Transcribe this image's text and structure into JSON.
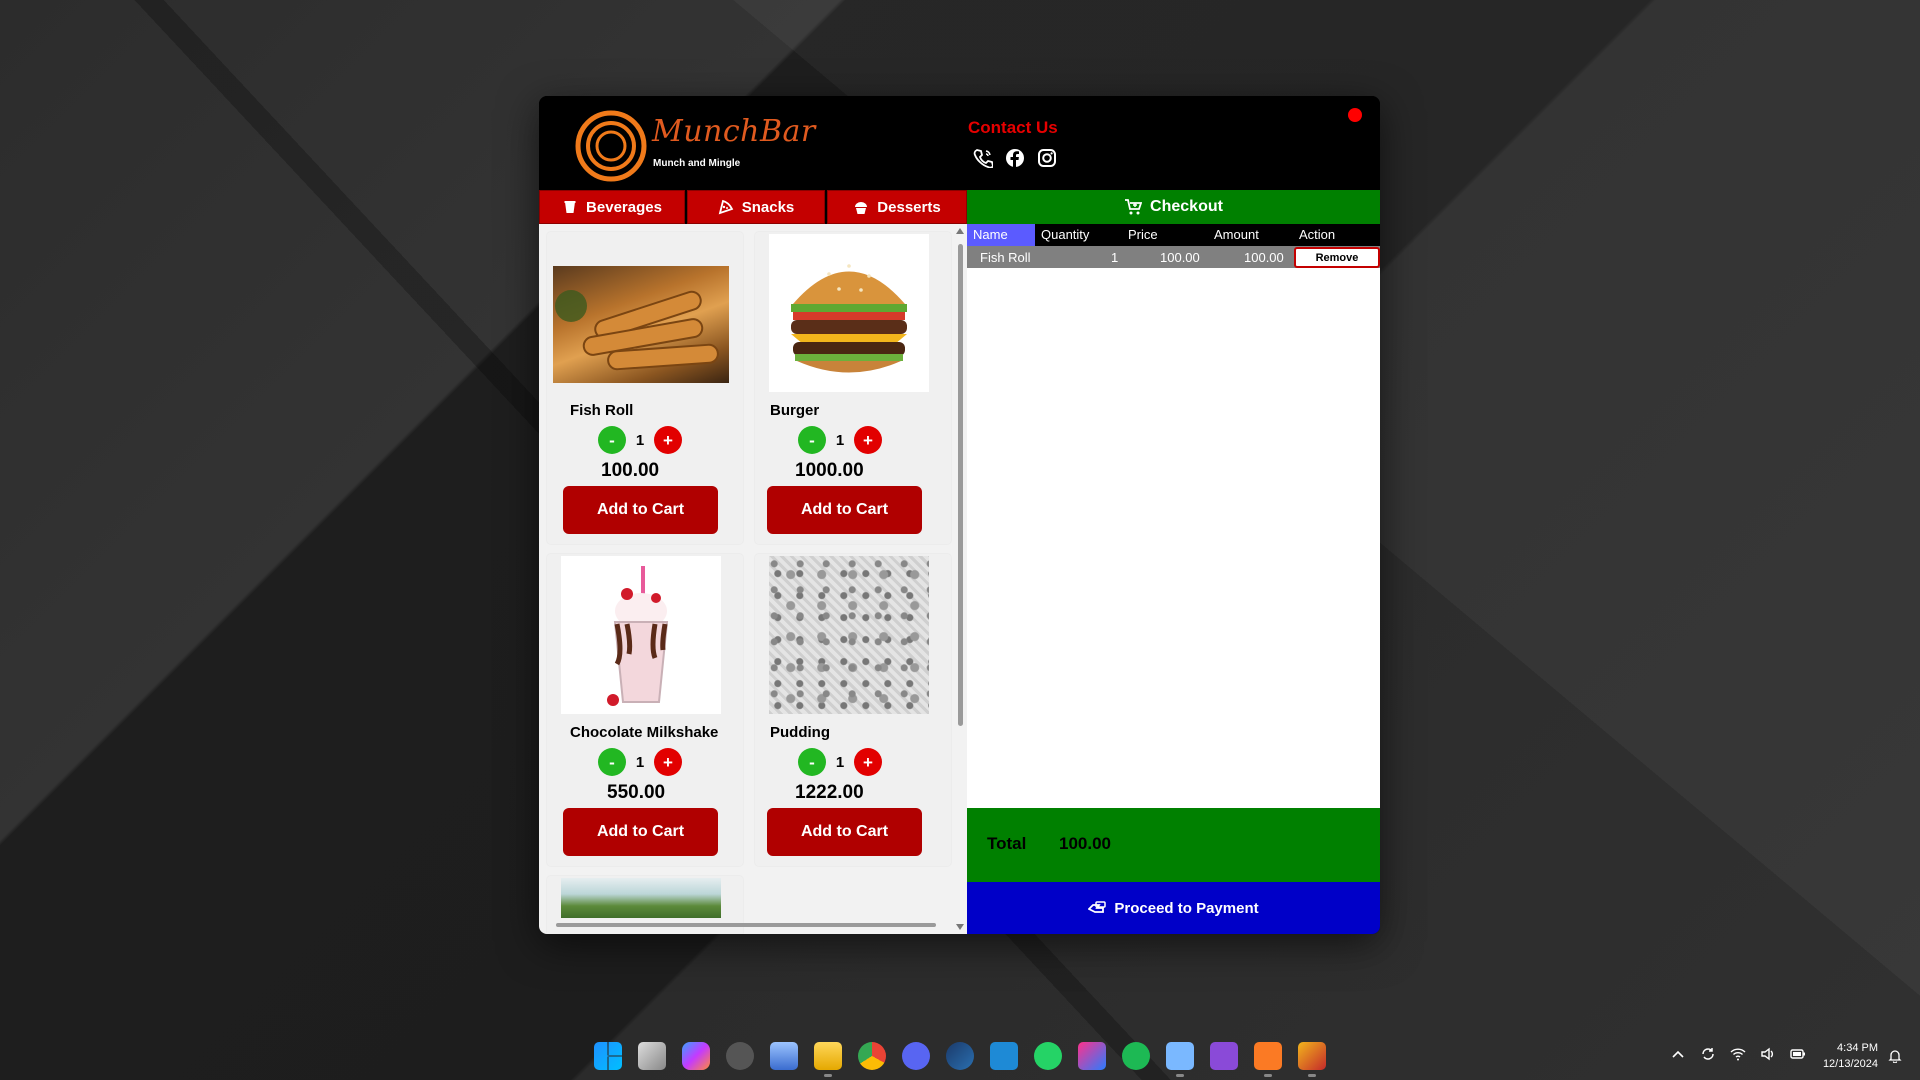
{
  "header": {
    "brand_name": "MunchBar",
    "brand_tagline": "Munch and Mingle",
    "contact_title": "Contact Us",
    "contact_icons": [
      "phone-icon",
      "facebook-icon",
      "instagram-icon"
    ],
    "close_color": "#ff0000"
  },
  "tabs": [
    {
      "label": "Beverages",
      "icon": "cup-icon"
    },
    {
      "label": "Snacks",
      "icon": "pizza-slice-icon"
    },
    {
      "label": "Desserts",
      "icon": "cupcake-icon"
    }
  ],
  "products": [
    {
      "name": "Fish Roll",
      "qty": "1",
      "price": "100.00",
      "button": "Add to Cart",
      "image": "fish-roll-image"
    },
    {
      "name": "Burger",
      "qty": "1",
      "price": "1000.00",
      "button": "Add to Cart",
      "image": "burger-image"
    },
    {
      "name": "Chocolate Milkshake",
      "qty": "1",
      "price": "550.00",
      "button": "Add to Cart",
      "image": "milkshake-image"
    },
    {
      "name": "Pudding",
      "qty": "1",
      "price": "1222.00",
      "button": "Add to Cart",
      "image": "pattern-placeholder-image"
    }
  ],
  "stepper": {
    "minus": "-",
    "plus": "+"
  },
  "checkout": {
    "title": "Checkout",
    "columns": [
      "Name",
      "Quantity",
      "Price",
      "Amount",
      "Action"
    ],
    "rows": [
      {
        "name": "Fish Roll",
        "quantity": "1",
        "price": "100.00",
        "amount": "100.00",
        "action": "Remove"
      }
    ],
    "total_label": "Total",
    "total_value": "100.00",
    "pay_button": "Proceed to Payment"
  },
  "colors": {
    "tab_red": "#c40000",
    "checkout_green": "#008000",
    "pay_blue": "#0000c8",
    "accent_orange": "#e05a1f"
  },
  "taskbar": {
    "apps": [
      "windows-start-icon",
      "task-view-icon",
      "copilot-icon",
      "unity-icon",
      "photos-icon",
      "file-explorer-icon",
      "chrome-icon",
      "discord-icon",
      "steam-icon",
      "vscode-icon",
      "whatsapp-icon",
      "intellij-icon",
      "spotify-icon",
      "notepad-icon",
      "visual-studio-icon",
      "xampp-icon",
      "app-icon"
    ],
    "time": "4:34 PM",
    "date": "12/13/2024"
  }
}
